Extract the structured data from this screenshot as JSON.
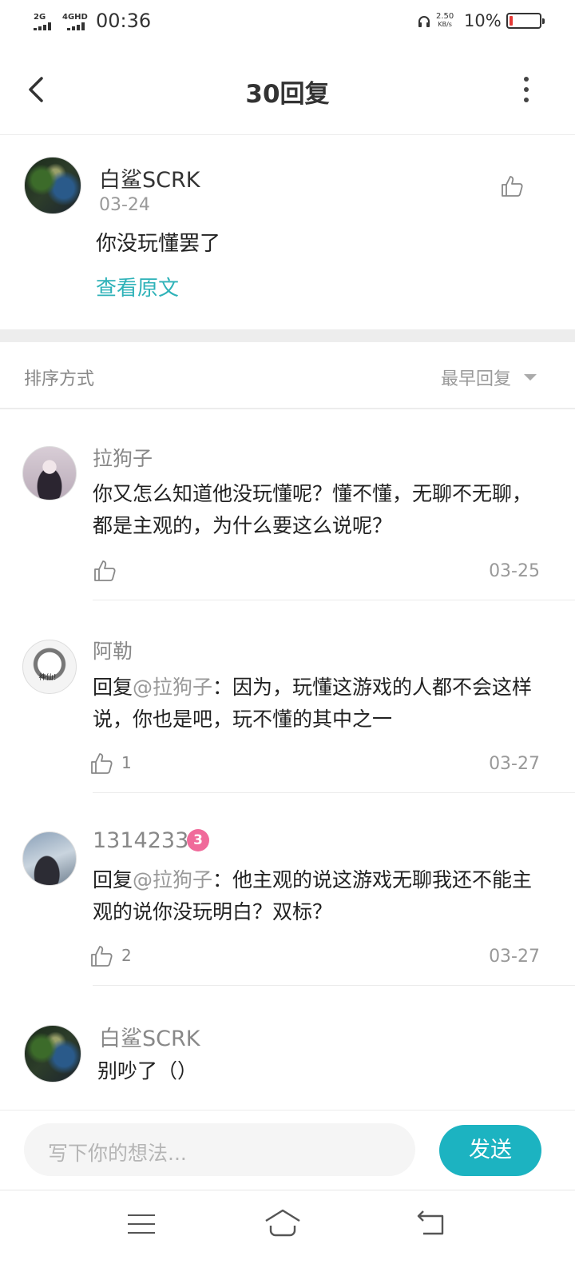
{
  "status_bar": {
    "sim1": "2G",
    "sim2": "4GHD",
    "time": "00:36",
    "speed_value": "2.50",
    "speed_unit": "KB/s",
    "battery": "10%",
    "battery_level": 0.1,
    "battery_color": "#e53935"
  },
  "header": {
    "title": "30回复"
  },
  "original_post": {
    "author": "白鲨SCRK",
    "date": "03-24",
    "text": "你没玩懂罢了",
    "view_original": "查看原文"
  },
  "sort": {
    "label": "排序方式",
    "value": "最早回复"
  },
  "replies": [
    {
      "author": "拉狗子",
      "text": "你又怎么知道他没玩懂呢？懂不懂，无聊不无聊，都是主观的，为什么要这么说呢？",
      "likes": "",
      "date": "03-25"
    },
    {
      "author": "阿勒",
      "avatar_text": "神仙！",
      "reply_prefix": "回复",
      "mention": "@拉狗子",
      "text": "：因为，玩懂这游戏的人都不会这样说，你也是吧，玩不懂的其中之一",
      "likes": "1",
      "date": "03-27"
    },
    {
      "author": "1314233",
      "badge": "3",
      "reply_prefix": "回复",
      "mention": "@拉狗子",
      "text": "：他主观的说这游戏无聊我还不能主观的说你没玩明白？双标？",
      "likes": "2",
      "date": "03-27"
    },
    {
      "author": "白鲨SCRK",
      "text": "别吵了（）"
    }
  ],
  "composer": {
    "placeholder": "写下你的想法...",
    "send_label": "发送",
    "accent": "#1cb3c1"
  },
  "icons": {
    "back": "chevron-left-icon",
    "more": "more-vertical-icon",
    "like": "thumbs-up-icon",
    "nav_menu": "menu-icon",
    "nav_home": "home-icon",
    "nav_back": "back-icon"
  }
}
